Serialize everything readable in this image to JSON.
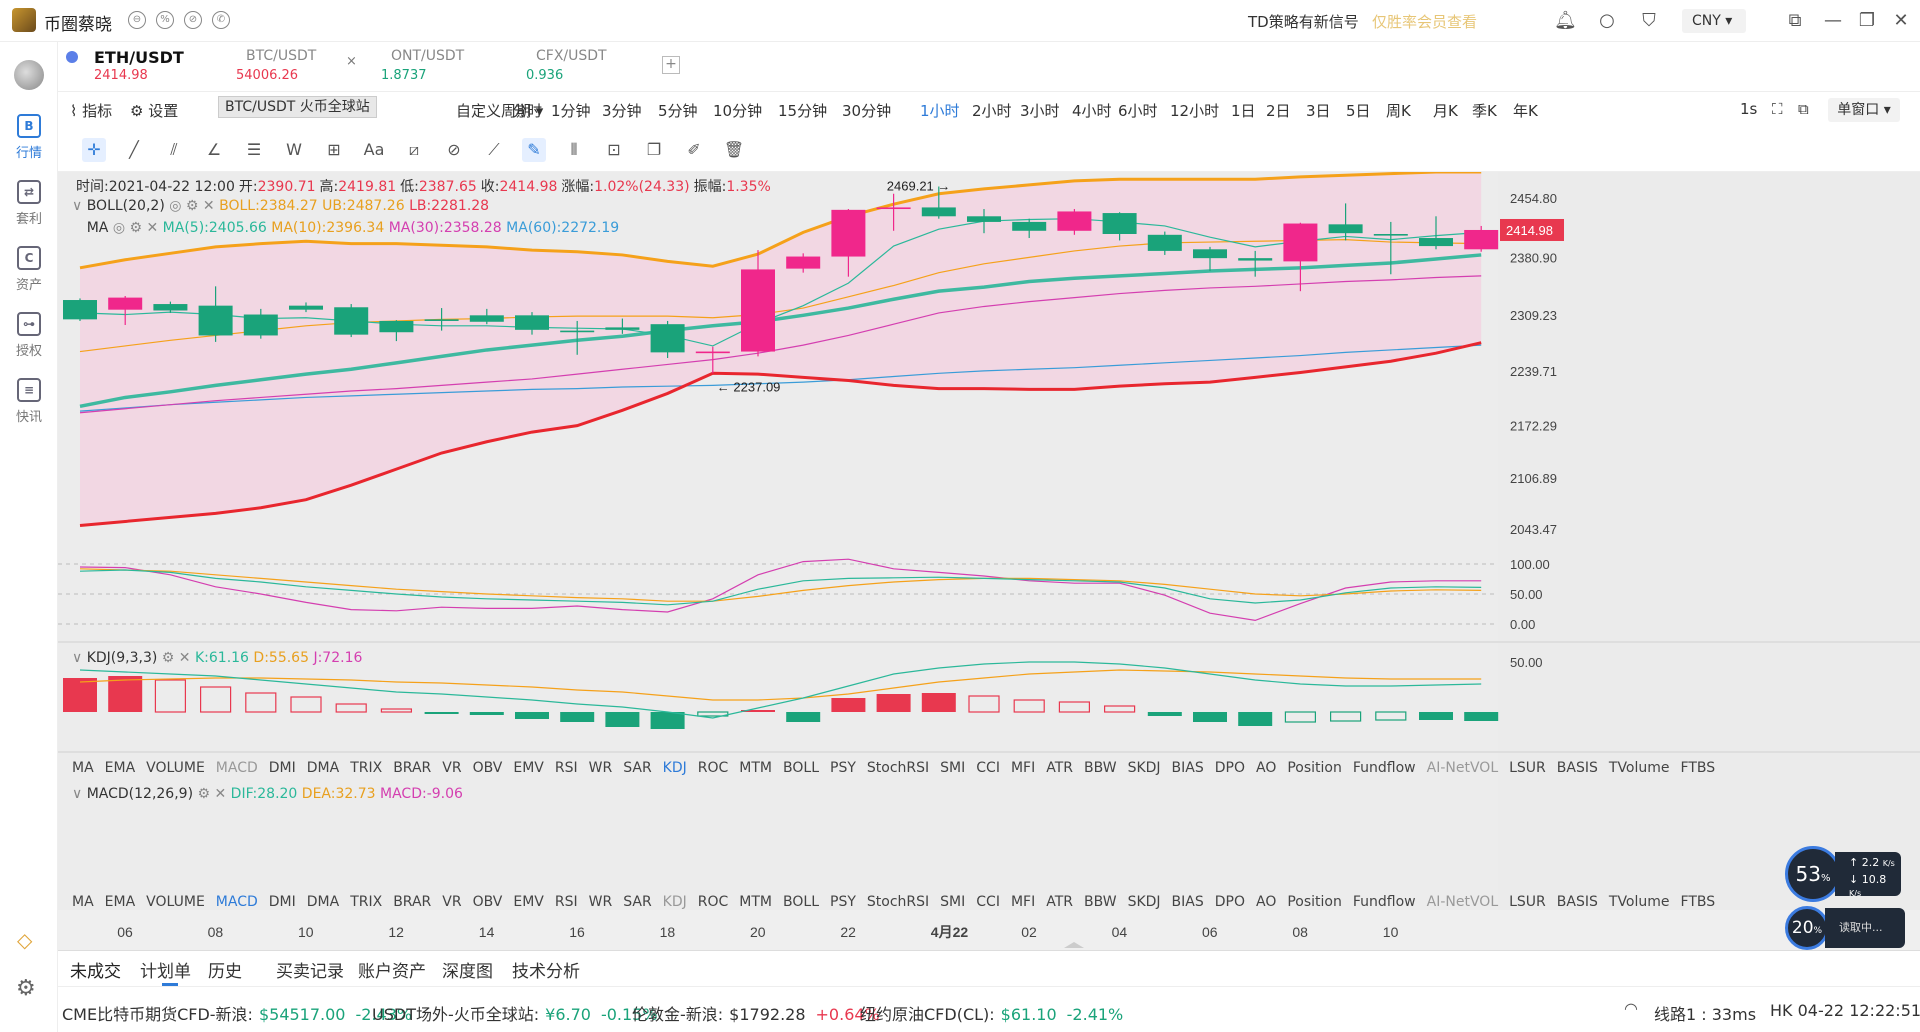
{
  "app": {
    "name": "币圈蔡晓"
  },
  "header": {
    "signal_text": "TD策略有新信号",
    "signal_blurred": "仅胜率会员查看",
    "currency": "CNY"
  },
  "sidebar": {
    "items": [
      {
        "label": "行情",
        "glyph": "B",
        "active": true
      },
      {
        "label": "套利",
        "glyph": "⇄",
        "active": false
      },
      {
        "label": "资产",
        "glyph": "C",
        "active": false
      },
      {
        "label": "授权",
        "glyph": "⊶",
        "active": false
      },
      {
        "label": "快讯",
        "glyph": "≡",
        "active": false
      }
    ]
  },
  "tabs": [
    {
      "symbol": "ETH/USDT",
      "price": "2414.98",
      "price_color": "#e8384f",
      "active": true
    },
    {
      "symbol": "BTC/USDT",
      "price": "54006.26",
      "price_color": "#e8384f",
      "active": false
    },
    {
      "symbol": "ONT/USDT",
      "price": "1.8737",
      "price_color": "#1aa37a",
      "active": false
    },
    {
      "symbol": "CFX/USDT",
      "price": "0.936",
      "price_color": "#1aa37a",
      "active": false
    }
  ],
  "toolbar": {
    "indicator_label": "指标",
    "settings_label": "设置",
    "tooltip": "BTC/USDT 火币全球站",
    "winrate_label": "胜率",
    "custom_period": "自定义周期",
    "periods": [
      "分时",
      "1分钟",
      "3分钟",
      "5分钟",
      "10分钟",
      "15分钟",
      "30分钟",
      "1小时",
      "2小时",
      "3小时",
      "4小时",
      "6小时",
      "12小时",
      "1日",
      "2日",
      "3日",
      "5日",
      "周K",
      "月K",
      "季K",
      "年K"
    ],
    "active_period": "1小时",
    "interval": "1s",
    "window_mode": "单窗口"
  },
  "info": {
    "ohlc": [
      {
        "label": "时间:",
        "value": "2021-04-22 12:00"
      },
      {
        "label": "开:",
        "value": "2390.71"
      },
      {
        "label": "高:",
        "value": "2419.81"
      },
      {
        "label": "低:",
        "value": "2387.65"
      },
      {
        "label": "收:",
        "value": "2414.98"
      },
      {
        "label": "涨幅:",
        "value": "1.02%(24.33)"
      },
      {
        "label": "振幅:",
        "value": "1.35%"
      }
    ],
    "boll": {
      "name": "BOLL(20,2)",
      "boll": "BOLL:2384.27",
      "ub": "UB:2487.26",
      "lb": "LB:2281.28"
    },
    "ma": {
      "name": "MA",
      "ma5": "MA(5):2405.66",
      "ma10": "MA(10):2396.34",
      "ma30": "MA(30):2358.28",
      "ma60": "MA(60):2272.19"
    },
    "kdj": {
      "name": "KDJ(9,3,3)",
      "k": "K:61.16",
      "d": "D:55.65",
      "j": "J:72.16"
    },
    "macd": {
      "name": "MACD(12,26,9)",
      "dif": "DIF:28.20",
      "dea": "DEA:32.73",
      "macd": "MACD:-9.06"
    }
  },
  "indicator_list": [
    "MA",
    "EMA",
    "VOLUME",
    "MACD",
    "DMI",
    "DMA",
    "TRIX",
    "BRAR",
    "VR",
    "OBV",
    "EMV",
    "RSI",
    "WR",
    "SAR",
    "KDJ",
    "ROC",
    "MTM",
    "BOLL",
    "PSY",
    "StochRSI",
    "SMI",
    "CCI",
    "MFI",
    "ATR",
    "BBW",
    "SKDJ",
    "BIAS",
    "DPO",
    "AO",
    "Position",
    "Fundflow",
    "AI-NetVOL",
    "LSUR",
    "BASIS",
    "TVolume",
    "FTBS"
  ],
  "chart_data": {
    "type": "candlestick",
    "y_ticks": [
      "2454.80",
      "2380.90",
      "2309.23",
      "2239.71",
      "2172.29",
      "2106.89",
      "2043.47"
    ],
    "current_price_label": "2414.98",
    "high_annotation": "2469.21",
    "low_annotation": "2237.09",
    "x_labels": [
      "06",
      "08",
      "10",
      "12",
      "14",
      "16",
      "18",
      "20",
      "22",
      "4月22",
      "02",
      "04",
      "06",
      "08",
      "10"
    ],
    "candles": [
      {
        "o": 2328,
        "c": 2304,
        "h": 2330,
        "l": 2302
      },
      {
        "o": 2316,
        "c": 2331,
        "h": 2333,
        "l": 2297
      },
      {
        "o": 2323,
        "c": 2315,
        "h": 2326,
        "l": 2312
      },
      {
        "o": 2321,
        "c": 2284,
        "h": 2345,
        "l": 2276
      },
      {
        "o": 2310,
        "c": 2284,
        "h": 2317,
        "l": 2280
      },
      {
        "o": 2321,
        "c": 2316,
        "h": 2325,
        "l": 2313
      },
      {
        "o": 2319,
        "c": 2285,
        "h": 2323,
        "l": 2282
      },
      {
        "o": 2302,
        "c": 2288,
        "h": 2303,
        "l": 2277
      },
      {
        "o": 2304,
        "c": 2302,
        "h": 2318,
        "l": 2290
      },
      {
        "o": 2309,
        "c": 2301,
        "h": 2317,
        "l": 2298
      },
      {
        "o": 2309,
        "c": 2291,
        "h": 2313,
        "l": 2285
      },
      {
        "o": 2290,
        "c": 2288,
        "h": 2302,
        "l": 2260
      },
      {
        "o": 2294,
        "c": 2291,
        "h": 2305,
        "l": 2286
      },
      {
        "o": 2298,
        "c": 2263,
        "h": 2302,
        "l": 2256
      },
      {
        "o": 2262,
        "c": 2264,
        "h": 2270,
        "l": 2237
      },
      {
        "o": 2264,
        "c": 2366,
        "h": 2390,
        "l": 2258
      },
      {
        "o": 2367,
        "c": 2382,
        "h": 2386,
        "l": 2362
      },
      {
        "o": 2382,
        "c": 2440,
        "h": 2441,
        "l": 2357
      },
      {
        "o": 2441,
        "c": 2443,
        "h": 2460,
        "l": 2414
      },
      {
        "o": 2443,
        "c": 2432,
        "h": 2469,
        "l": 2429
      },
      {
        "o": 2432,
        "c": 2425,
        "h": 2441,
        "l": 2411
      },
      {
        "o": 2425,
        "c": 2414,
        "h": 2429,
        "l": 2405
      },
      {
        "o": 2414,
        "c": 2438,
        "h": 2441,
        "l": 2409
      },
      {
        "o": 2436,
        "c": 2410,
        "h": 2437,
        "l": 2402
      },
      {
        "o": 2409,
        "c": 2389,
        "h": 2413,
        "l": 2384
      },
      {
        "o": 2391,
        "c": 2380,
        "h": 2394,
        "l": 2364
      },
      {
        "o": 2380,
        "c": 2377,
        "h": 2389,
        "l": 2357
      },
      {
        "o": 2376,
        "c": 2423,
        "h": 2424,
        "l": 2339
      },
      {
        "o": 2422,
        "c": 2411,
        "h": 2448,
        "l": 2402
      },
      {
        "o": 2410,
        "c": 2408,
        "h": 2425,
        "l": 2360
      },
      {
        "o": 2405,
        "c": 2395,
        "h": 2432,
        "l": 2391
      },
      {
        "o": 2391,
        "c": 2415,
        "h": 2420,
        "l": 2388
      }
    ],
    "ub": [
      2368,
      2378,
      2386,
      2394,
      2398,
      2401,
      2398,
      2398,
      2396,
      2394,
      2390,
      2388,
      2384,
      2376,
      2370,
      2385,
      2412,
      2432,
      2447,
      2460,
      2466,
      2471,
      2476,
      2478,
      2478,
      2478,
      2478,
      2481,
      2483,
      2485,
      2487,
      2487
    ],
    "lb": [
      2048,
      2053,
      2058,
      2063,
      2070,
      2080,
      2098,
      2118,
      2138,
      2152,
      2164,
      2172,
      2191,
      2212,
      2237,
      2236,
      2232,
      2228,
      2222,
      2218,
      2218,
      2217,
      2217,
      2221,
      2224,
      2226,
      2232,
      2238,
      2245,
      2252,
      2262,
      2275
    ],
    "ma_mid": [
      2196,
      2207,
      2214,
      2222,
      2229,
      2236,
      2242,
      2250,
      2258,
      2266,
      2272,
      2278,
      2283,
      2290,
      2296,
      2301,
      2309,
      2318,
      2329,
      2339,
      2344,
      2351,
      2355,
      2358,
      2361,
      2364,
      2366,
      2368,
      2371,
      2374,
      2379,
      2384
    ],
    "ma_fast": [
      2312,
      2310,
      2313,
      2310,
      2305,
      2306,
      2302,
      2298,
      2296,
      2296,
      2294,
      2293,
      2292,
      2284,
      2271,
      2299,
      2321,
      2349,
      2395,
      2416,
      2426,
      2428,
      2429,
      2425,
      2420,
      2406,
      2394,
      2401,
      2407,
      2403,
      2408,
      2412
    ],
    "ma_slow": [
      2264,
      2271,
      2278,
      2284,
      2290,
      2296,
      2300,
      2302,
      2304,
      2305,
      2307,
      2308,
      2308,
      2308,
      2306,
      2310,
      2318,
      2332,
      2346,
      2362,
      2373,
      2381,
      2389,
      2395,
      2399,
      2400,
      2401,
      2402,
      2403,
      2400,
      2399,
      2398
    ],
    "ma_30": [
      2188,
      2193,
      2198,
      2203,
      2207,
      2211,
      2215,
      2218,
      2222,
      2226,
      2230,
      2236,
      2242,
      2248,
      2254,
      2262,
      2272,
      2284,
      2298,
      2312,
      2320,
      2326,
      2331,
      2336,
      2340,
      2343,
      2345,
      2348,
      2351,
      2353,
      2356,
      2358
    ],
    "ma_60": [
      2190,
      2194,
      2198,
      2201,
      2204,
      2207,
      2209,
      2211,
      2213,
      2215,
      2217,
      2218,
      2220,
      2221,
      2222,
      2224,
      2226,
      2229,
      2233,
      2237,
      2240,
      2242,
      2244,
      2247,
      2250,
      2253,
      2256,
      2259,
      2263,
      2266,
      2269,
      2272
    ],
    "kdj_ticks": [
      "100.00",
      "50.00",
      "0.00"
    ],
    "kdj_k": [
      88,
      90,
      86,
      76,
      70,
      62,
      56,
      50,
      45,
      42,
      40,
      38,
      36,
      32,
      38,
      58,
      72,
      76,
      77,
      78,
      76,
      74,
      72,
      70,
      60,
      42,
      35,
      40,
      52,
      60,
      62,
      61
    ],
    "kdj_d": [
      92,
      90,
      88,
      82,
      76,
      70,
      64,
      58,
      54,
      50,
      47,
      44,
      42,
      38,
      38,
      46,
      56,
      64,
      70,
      74,
      76,
      76,
      74,
      72,
      66,
      58,
      50,
      47,
      50,
      55,
      57,
      56
    ],
    "kdj_j": [
      95,
      94,
      82,
      62,
      50,
      36,
      24,
      22,
      28,
      26,
      26,
      30,
      24,
      20,
      42,
      82,
      104,
      108,
      92,
      86,
      80,
      72,
      68,
      68,
      48,
      18,
      6,
      34,
      60,
      70,
      72,
      72
    ],
    "macd_ticks": [
      "50.00"
    ],
    "macd_dif": [
      42,
      40,
      38,
      36,
      32,
      28,
      24,
      20,
      18,
      15,
      12,
      8,
      5,
      0,
      -6,
      4,
      14,
      26,
      38,
      44,
      48,
      50,
      50,
      48,
      44,
      38,
      32,
      28,
      26,
      26,
      27,
      28
    ],
    "macd_dea": [
      30,
      32,
      33,
      34,
      34,
      33,
      32,
      30,
      29,
      27,
      25,
      22,
      20,
      16,
      12,
      12,
      14,
      18,
      24,
      30,
      34,
      38,
      40,
      42,
      41,
      40,
      38,
      36,
      34,
      33,
      33,
      33
    ],
    "macd_hist": [
      34,
      36,
      32,
      25,
      19,
      15,
      8,
      3,
      -2,
      -3,
      -7,
      -10,
      -15,
      -17,
      -4,
      2,
      -10,
      14,
      18,
      19,
      16,
      12,
      10,
      6,
      -4,
      -10,
      -14,
      -10,
      -9,
      -8,
      -8,
      -9
    ],
    "window_labels": {
      "kdj_name": "KDJ(9,3,3)",
      "macd_name": "MACD(12,26,9)"
    }
  },
  "bottom_tabs": [
    "未成交",
    "计划单",
    "历史",
    "买卖记录",
    "账户资产",
    "深度图",
    "技术分析"
  ],
  "ticker": [
    {
      "name": "CME比特币期货CFD-新浪:",
      "price": "$54517.00",
      "change": "-2.43%",
      "price_color": "#1aa37a",
      "change_color": "#1aa37a"
    },
    {
      "name": "USDT场外-火币全球站:",
      "price": "¥6.70",
      "change": "-0.15%",
      "price_color": "#1aa37a",
      "change_color": "#1aa37a"
    },
    {
      "name": "伦敦金-新浪:",
      "price": "$1792.28",
      "change": "+0.64%",
      "price_color": "#333",
      "change_color": "#e8384f"
    },
    {
      "name": "纽约原油CFD(CL):",
      "price": "$61.10",
      "change": "-2.41%",
      "price_color": "#1aa37a",
      "change_color": "#1aa37a"
    }
  ],
  "status": {
    "line": "线路1 : 33ms",
    "time": "HK 04-22 12:22:51"
  },
  "speed": {
    "cpu": "53",
    "mem": "20",
    "up": "2.2",
    "down": "10.8",
    "unit": "K/s",
    "reading": "读取中..."
  }
}
